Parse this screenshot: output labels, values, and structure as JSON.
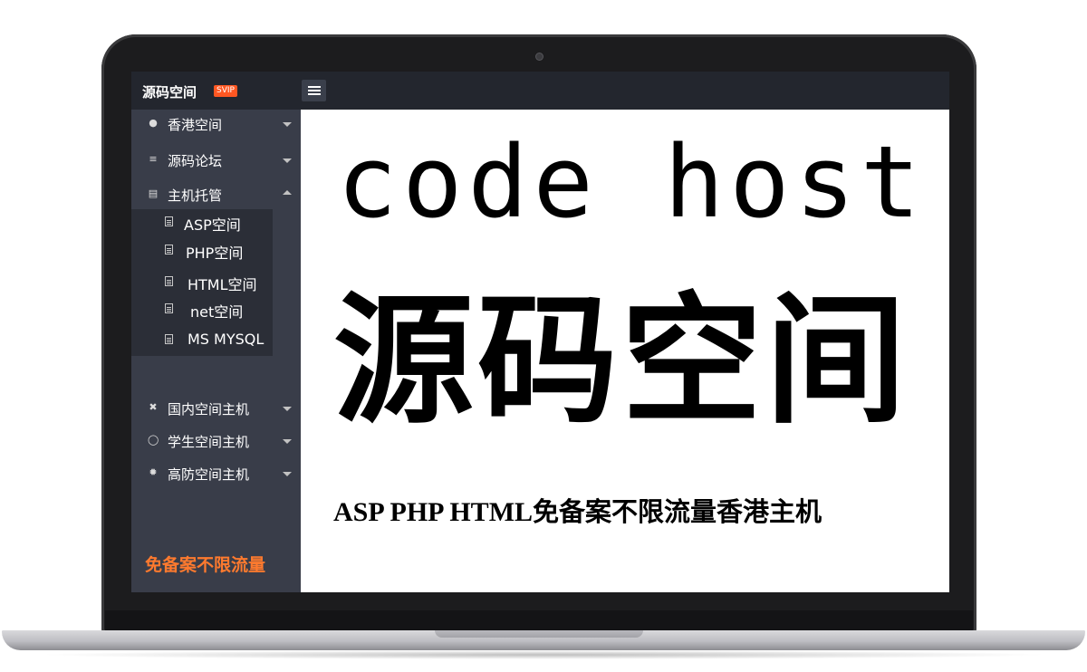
{
  "header": {
    "logo_text": "源码空间",
    "badge": "SVIP",
    "menu_icon": "hamburger-icon"
  },
  "sidebar": {
    "items": [
      {
        "label": "香港空间",
        "icon": "globe-icon",
        "expanded": false
      },
      {
        "label": "源码论坛",
        "icon": "sliders-icon",
        "expanded": false
      },
      {
        "label": "主机托管",
        "icon": "document-icon",
        "expanded": true
      },
      {
        "label": "国内空间主机",
        "icon": "shuffle-icon",
        "expanded": false
      },
      {
        "label": "学生空间主机",
        "icon": "user-icon",
        "expanded": false
      },
      {
        "label": "高防空间主机",
        "icon": "gear-icon",
        "expanded": false
      }
    ],
    "sub_items": [
      {
        "label": "ASP空间",
        "icon": "document-icon"
      },
      {
        "label": "PHP空间",
        "icon": "document-icon"
      },
      {
        "label": "HTML空间",
        "icon": "document-icon"
      },
      {
        "label": "net空间",
        "icon": "document-icon"
      },
      {
        "label": "MS MYSQL",
        "icon": "document-icon"
      }
    ],
    "promo": "免备案不限流量"
  },
  "main": {
    "hero_en": "code host",
    "hero_zh": "源码空间",
    "tagline_en": "ASP PHP HTML",
    "tagline_zh": "免备案不限流量香港主机"
  },
  "colors": {
    "topbar": "#23262e",
    "sidebar": "#393d49",
    "subnav": "#2b2e37",
    "badge": "#ff5722",
    "promo": "#ff7a2e"
  }
}
